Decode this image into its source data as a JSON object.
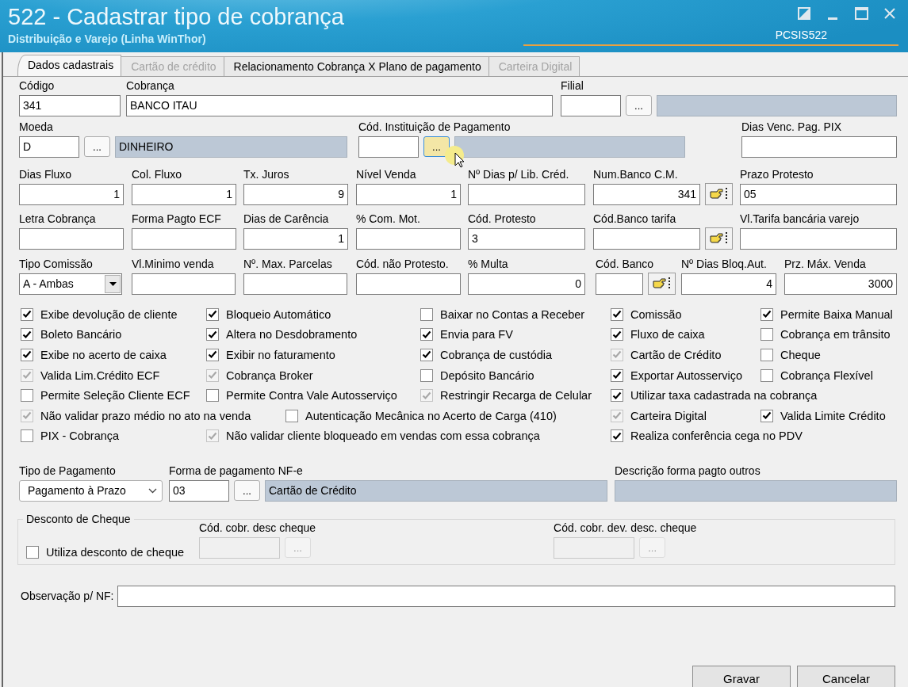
{
  "window": {
    "title": "522 - Cadastrar tipo de cobrança",
    "subtitle": "Distribuição e Varejo (Linha WinThor)",
    "program_code": "PCSIS522"
  },
  "tabs": [
    {
      "label": "Dados cadastrais",
      "selected": true,
      "disabled": false
    },
    {
      "label": "Cartão de crédito",
      "selected": false,
      "disabled": true
    },
    {
      "label": "Relacionamento Cobrança X Plano de pagamento",
      "selected": false,
      "disabled": false
    },
    {
      "label": "Carteira Digital",
      "selected": false,
      "disabled": true
    }
  ],
  "field_rows": [
    [
      {
        "kind": "text",
        "label": "Código",
        "value": "341"
      },
      {
        "kind": "text",
        "label": "Cobrança",
        "value": "BANCO ITAU"
      },
      {
        "kind": "lookup",
        "label": "Filial",
        "button": "...",
        "hovered": false
      }
    ],
    [
      {
        "kind": "lookup",
        "label": "Moeda",
        "value": "D",
        "button": "...",
        "description": "DINHEIRO",
        "hovered": false
      },
      {
        "kind": "lookup",
        "label": "Cód. Instituição de Pagamento",
        "button": "...",
        "hovered": true
      },
      {
        "kind": "text",
        "label": "Dias Venc. Pag. PIX"
      }
    ],
    [
      {
        "kind": "number",
        "label": "Dias Fluxo",
        "value": "1"
      },
      {
        "kind": "number",
        "label": "Col. Fluxo",
        "value": "1"
      },
      {
        "kind": "number",
        "label": "Tx. Juros",
        "value": "9"
      },
      {
        "kind": "number",
        "label": "Nível Venda",
        "value": "1"
      },
      {
        "kind": "text",
        "label": "Nº Dias p/ Lib. Créd."
      },
      {
        "kind": "finder",
        "label": "Num.Banco C.M.",
        "value": "341"
      },
      {
        "kind": "text",
        "label": "Prazo Protesto",
        "value": "05"
      }
    ],
    [
      {
        "kind": "text",
        "label": "Letra Cobrança"
      },
      {
        "kind": "text",
        "label": "Forma Pagto ECF"
      },
      {
        "kind": "number",
        "label": "Dias de Carência",
        "value": "1"
      },
      {
        "kind": "text",
        "label": "% Com. Mot."
      },
      {
        "kind": "text",
        "label": "Cód. Protesto",
        "value": "3"
      },
      {
        "kind": "finder",
        "label": "Cód.Banco tarifa"
      },
      {
        "kind": "text",
        "label": "Vl.Tarifa bancária varejo"
      }
    ],
    [
      {
        "kind": "combo",
        "label": "Tipo Comissão",
        "value": "A - Ambas"
      },
      {
        "kind": "text",
        "label": "Vl.Minimo venda"
      },
      {
        "kind": "text",
        "label": "Nº. Max. Parcelas"
      },
      {
        "kind": "text",
        "label": "Cód. não Protesto."
      },
      {
        "kind": "number",
        "label": "% Multa",
        "value": "0"
      },
      {
        "kind": "finder",
        "label": "Cód. Banco"
      },
      {
        "kind": "number",
        "label": "Nº Dias Bloq.Aut.",
        "value": "4"
      },
      {
        "kind": "number",
        "label": "Prz. Máx. Venda",
        "value": "3000"
      }
    ]
  ],
  "options": [
    [
      {
        "label": "Exibe devolução de cliente",
        "checked": true,
        "disabled": false
      },
      {
        "label": "Bloqueio Automático",
        "checked": true,
        "disabled": false
      },
      {
        "label": "Baixar no Contas a Receber",
        "checked": false,
        "disabled": false
      },
      {
        "label": "Comissão",
        "checked": true,
        "disabled": false
      },
      {
        "label": "Permite Baixa Manual",
        "checked": true,
        "disabled": false
      }
    ],
    [
      {
        "label": "Boleto Bancário",
        "checked": true,
        "disabled": false
      },
      {
        "label": "Altera no Desdobramento",
        "checked": true,
        "disabled": false
      },
      {
        "label": "Envia para FV",
        "checked": true,
        "disabled": false
      },
      {
        "label": "Fluxo de caixa",
        "checked": true,
        "disabled": false
      },
      {
        "label": "Cobrança em trânsito",
        "checked": false,
        "disabled": false
      }
    ],
    [
      {
        "label": "Exibe no acerto de caixa",
        "checked": true,
        "disabled": false
      },
      {
        "label": "Exibir no faturamento",
        "checked": true,
        "disabled": false
      },
      {
        "label": "Cobrança de custódia",
        "checked": true,
        "disabled": false
      },
      {
        "label": "Cartão de Crédito",
        "checked": true,
        "disabled": true
      },
      {
        "label": "Cheque",
        "checked": false,
        "disabled": false
      }
    ],
    [
      {
        "label": "Valida Lim.Crédito ECF",
        "checked": true,
        "disabled": true
      },
      {
        "label": "Cobrança Broker",
        "checked": true,
        "disabled": true
      },
      {
        "label": "Depósito Bancário",
        "checked": false,
        "disabled": false
      },
      {
        "label": "Exportar Autosserviço",
        "checked": true,
        "disabled": false
      },
      {
        "label": "Cobrança Flexível",
        "checked": false,
        "disabled": false
      }
    ],
    [
      {
        "label": "Permite Seleção Cliente ECF",
        "checked": false,
        "disabled": false
      },
      {
        "label": "Permite Contra Vale Autosserviço",
        "checked": false,
        "disabled": false
      },
      {
        "label": "Restringir Recarga de Celular",
        "checked": true,
        "disabled": true
      },
      {
        "label": "Utilizar taxa cadastrada na cobrança",
        "checked": true,
        "disabled": false
      }
    ],
    [
      {
        "label": "Não validar prazo médio no ato na venda",
        "checked": true,
        "disabled": true
      },
      {
        "label": "Autenticação Mecânica no Acerto de Carga (410)",
        "checked": false,
        "disabled": false
      },
      {
        "label": "Carteira Digital",
        "checked": true,
        "disabled": true
      },
      {
        "label": "Valida Limite Crédito",
        "checked": true,
        "disabled": false
      }
    ],
    [
      {
        "label": "PIX - Cobrança",
        "checked": false,
        "disabled": false
      },
      {
        "label": "Não validar cliente bloqueado em vendas com essa cobrança",
        "checked": true,
        "disabled": true
      },
      {
        "label": "Realiza conferência cega no PDV",
        "checked": true,
        "disabled": false
      }
    ]
  ],
  "payment_row": [
    {
      "kind": "dropdown",
      "label": "Tipo de Pagamento",
      "value": "Pagamento à Prazo"
    },
    {
      "kind": "lookup",
      "label": "Forma de pagamento NF-e",
      "value": "03",
      "button": "...",
      "description": "Cartão de Crédito",
      "hovered": false
    },
    {
      "kind": "readonly",
      "label": "Descrição forma pagto outros"
    }
  ],
  "cheque_group": {
    "title": "Desconto de Cheque",
    "checkbox": {
      "label": "Utiliza desconto de cheque",
      "checked": false,
      "disabled": false
    },
    "fields": [
      {
        "label": "Cód. cobr. desc cheque",
        "button": "...",
        "disabled": true
      },
      {
        "label": "Cód. cobr. dev. desc. cheque",
        "button": "...",
        "disabled": true
      }
    ]
  },
  "observation": {
    "label": "Observação p/ NF:"
  },
  "buttons": [
    {
      "label": "Gravar"
    },
    {
      "label": "Cancelar"
    }
  ]
}
